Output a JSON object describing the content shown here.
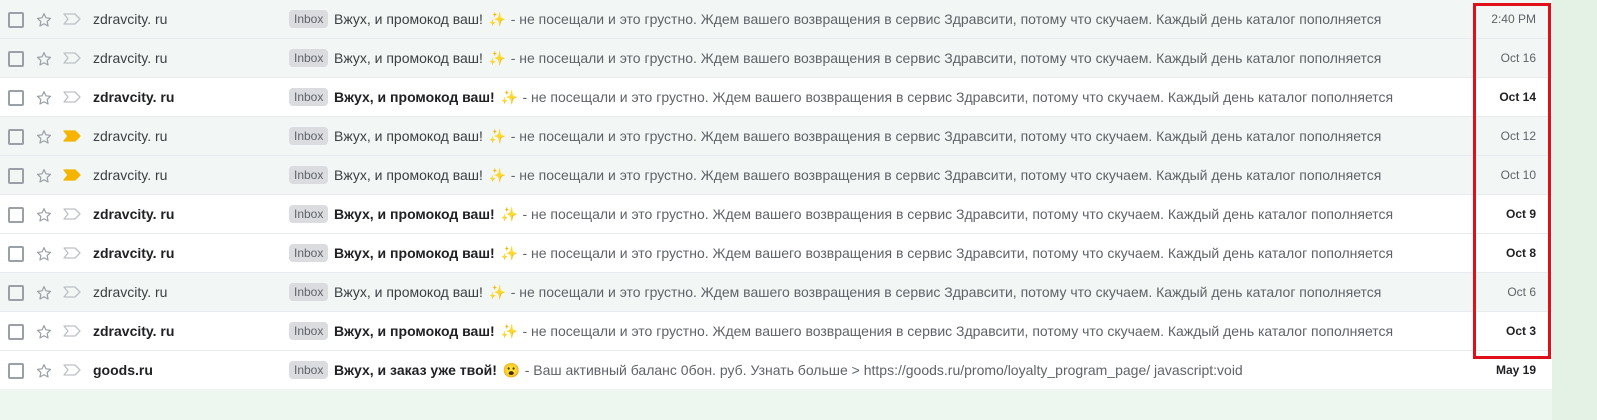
{
  "emails": [
    {
      "sender": "zdravcity. ru",
      "label": "Inbox",
      "subject": "Вжух, и промокод ваш!",
      "emoji": "✨",
      "snippet": "- не посещали и это грустно. Ждем вашего возвращения в сервис Здравсити, потому что скучаем. Каждый день каталог пополняется",
      "date": "2:40 PM",
      "unread": false,
      "important": false
    },
    {
      "sender": "zdravcity. ru",
      "label": "Inbox",
      "subject": "Вжух, и промокод ваш!",
      "emoji": "✨",
      "snippet": "- не посещали и это грустно. Ждем вашего возвращения в сервис Здравсити, потому что скучаем. Каждый день каталог пополняется",
      "date": "Oct 16",
      "unread": false,
      "important": false
    },
    {
      "sender": "zdravcity. ru",
      "label": "Inbox",
      "subject": "Вжух, и промокод ваш!",
      "emoji": "✨",
      "snippet": "- не посещали и это грустно. Ждем вашего возвращения в сервис Здравсити, потому что скучаем. Каждый день каталог пополняется",
      "date": "Oct 14",
      "unread": true,
      "important": false
    },
    {
      "sender": "zdravcity. ru",
      "label": "Inbox",
      "subject": "Вжух, и промокод ваш!",
      "emoji": "✨",
      "snippet": "- не посещали и это грустно. Ждем вашего возвращения в сервис Здравсити, потому что скучаем. Каждый день каталог пополняется",
      "date": "Oct 12",
      "unread": false,
      "important": true
    },
    {
      "sender": "zdravcity. ru",
      "label": "Inbox",
      "subject": "Вжух, и промокод ваш!",
      "emoji": "✨",
      "snippet": "- не посещали и это грустно. Ждем вашего возвращения в сервис Здравсити, потому что скучаем. Каждый день каталог пополняется",
      "date": "Oct 10",
      "unread": false,
      "important": true
    },
    {
      "sender": "zdravcity. ru",
      "label": "Inbox",
      "subject": "Вжух, и промокод ваш!",
      "emoji": "✨",
      "snippet": "- не посещали и это грустно. Ждем вашего возвращения в сервис Здравсити, потому что скучаем. Каждый день каталог пополняется",
      "date": "Oct 9",
      "unread": true,
      "important": false
    },
    {
      "sender": "zdravcity. ru",
      "label": "Inbox",
      "subject": "Вжух, и промокод ваш!",
      "emoji": "✨",
      "snippet": "- не посещали и это грустно. Ждем вашего возвращения в сервис Здравсити, потому что скучаем. Каждый день каталог пополняется",
      "date": "Oct 8",
      "unread": true,
      "important": false
    },
    {
      "sender": "zdravcity. ru",
      "label": "Inbox",
      "subject": "Вжух, и промокод ваш!",
      "emoji": "✨",
      "snippet": "- не посещали и это грустно. Ждем вашего возвращения в сервис Здравсити, потому что скучаем. Каждый день каталог пополняется",
      "date": "Oct 6",
      "unread": false,
      "important": false
    },
    {
      "sender": "zdravcity. ru",
      "label": "Inbox",
      "subject": "Вжух, и промокод ваш!",
      "emoji": "✨",
      "snippet": "- не посещали и это грустно. Ждем вашего возвращения в сервис Здравсити, потому что скучаем. Каждый день каталог пополняется",
      "date": "Oct 3",
      "unread": true,
      "important": false
    },
    {
      "sender": "goods.ru",
      "label": "Inbox",
      "subject": "Вжух, и заказ уже твой!",
      "emoji": "😮",
      "snippet": "-       Ваш активный баланс 0бон. руб. Узнать больше > https://goods.ru/promo/loyalty_program_page/ javascript:void",
      "date": "May 19",
      "unread": true,
      "important": false
    }
  ],
  "colors": {
    "highlight_frame": "#e0101a",
    "important_marker": "#f4b400"
  },
  "icons": {
    "checkbox": "checkbox-icon",
    "star": "star-icon",
    "important": "importance-marker-icon"
  }
}
